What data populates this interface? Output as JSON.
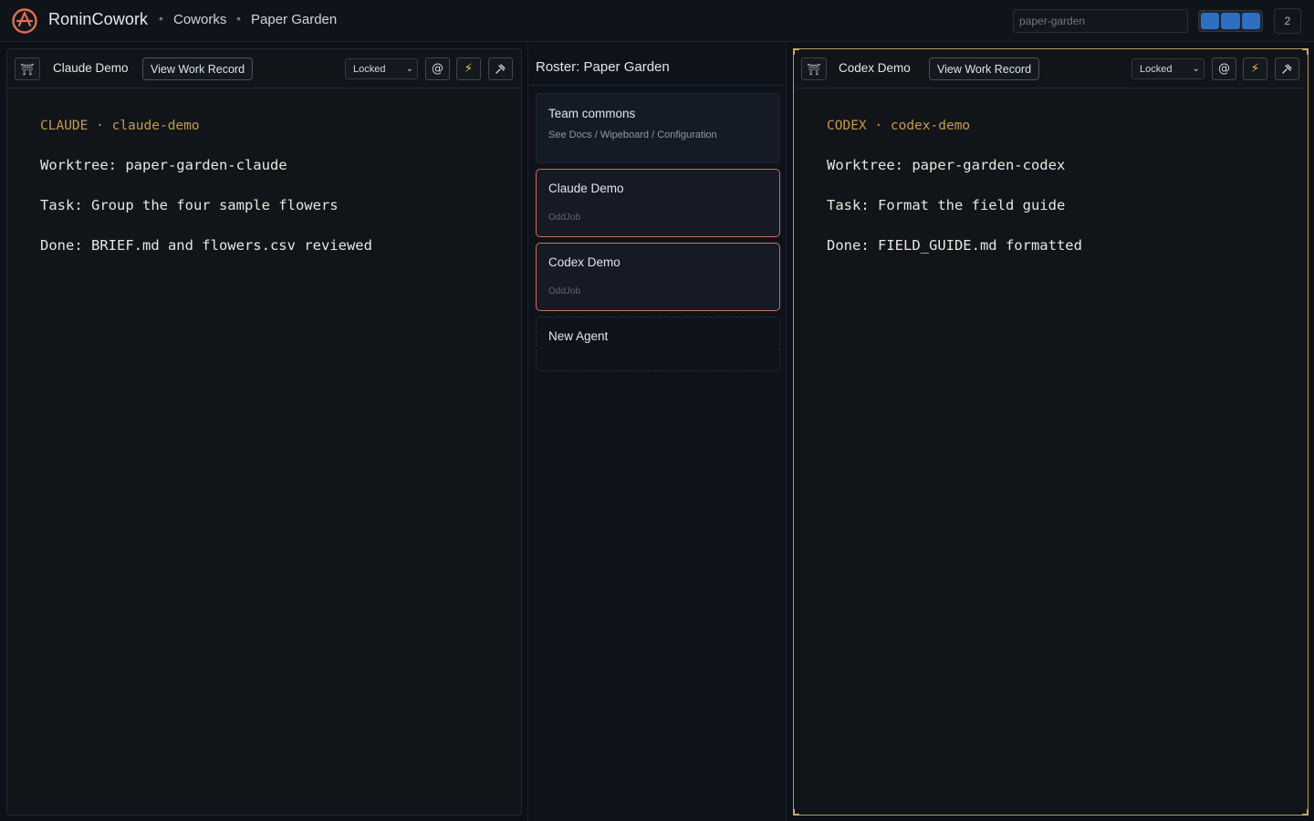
{
  "header": {
    "brand": "RoninCowork",
    "breadcrumbs": [
      "Coworks",
      "Paper Garden"
    ],
    "search": {
      "placeholder": "paper-garden",
      "value": ""
    },
    "count_badge": "2",
    "logo_icon": "ronin-logo-icon",
    "accent_color": "#e0704f"
  },
  "left_panel": {
    "agent_name": "Claude Demo",
    "view_record_label": "View Work Record",
    "lock_select": {
      "selected": "Locked"
    },
    "buttons": {
      "mention": "@",
      "bolt": "⚡",
      "pin": "⊹"
    },
    "terminal": {
      "header_name": "CLAUDE",
      "header_sep": "·",
      "header_id": "claude-demo",
      "lines": [
        "Worktree: paper-garden-claude",
        "Task: Group the four sample flowers",
        "Done: BRIEF.md and flowers.csv reviewed"
      ]
    }
  },
  "roster": {
    "title": "Roster: Paper Garden",
    "commons": {
      "title": "Team commons",
      "links": "See Docs / Wipeboard / Configuration"
    },
    "agents": [
      {
        "name": "Claude Demo",
        "role": "OddJob"
      },
      {
        "name": "Codex Demo",
        "role": "OddJob"
      }
    ],
    "new_agent_label": "New Agent"
  },
  "right_panel": {
    "agent_name": "Codex Demo",
    "view_record_label": "View Work Record",
    "lock_select": {
      "selected": "Locked"
    },
    "buttons": {
      "mention": "@",
      "bolt": "⚡",
      "pin": "⊹"
    },
    "terminal": {
      "header_name": "CODEX",
      "header_sep": "·",
      "header_id": "codex-demo",
      "lines": [
        "Worktree: paper-garden-codex",
        "Task: Format the field guide",
        "Done: FIELD_GUIDE.md formatted"
      ]
    }
  }
}
